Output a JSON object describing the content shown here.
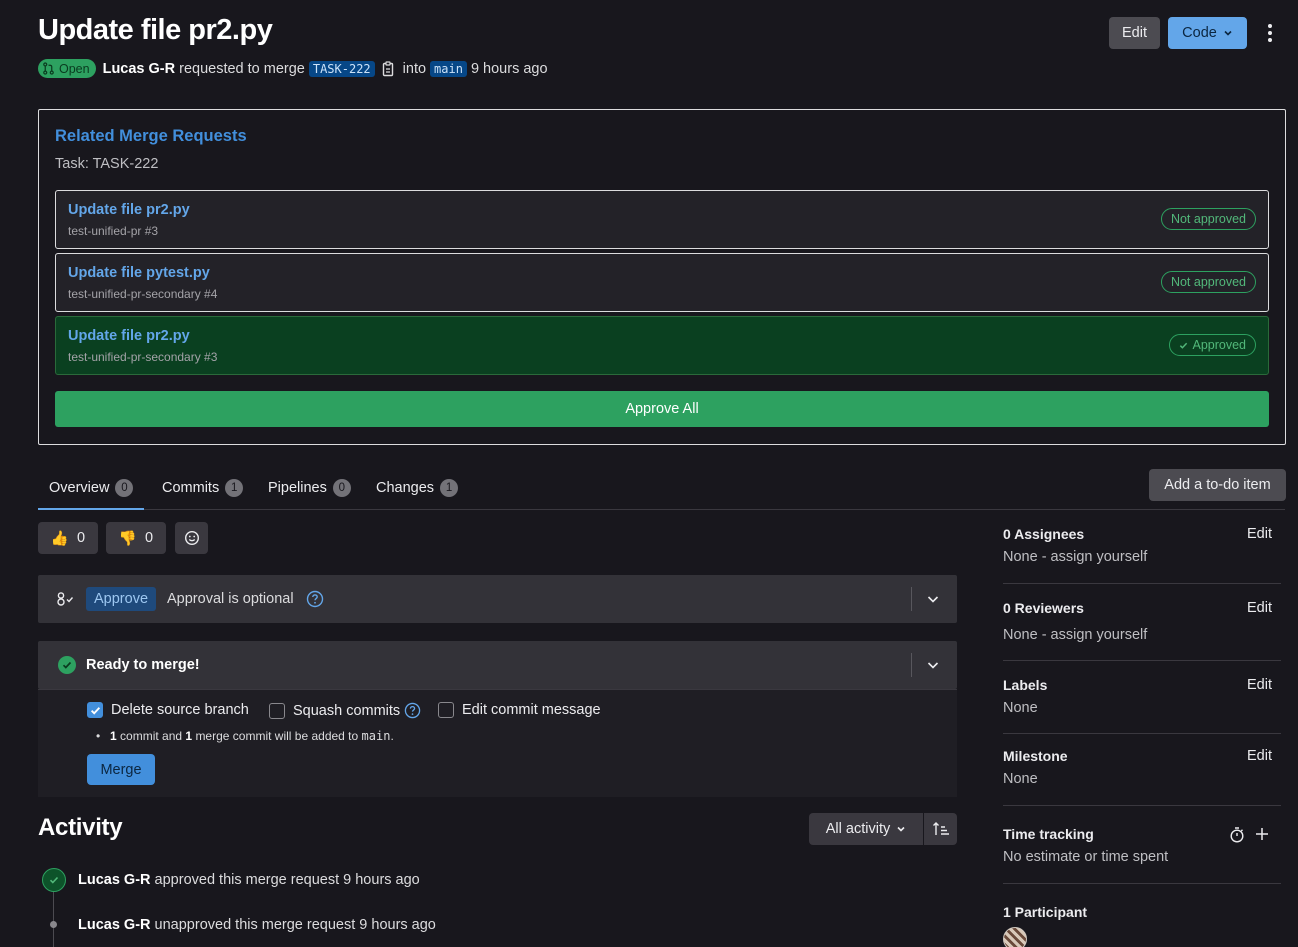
{
  "header": {
    "title": "Update file pr2.py",
    "status": "Open",
    "author": "Lucas G-R",
    "action_text": "requested to merge",
    "source_branch": "TASK-222",
    "into_text": "into",
    "target_branch": "main",
    "time": "9 hours ago",
    "edit_label": "Edit",
    "code_label": "Code"
  },
  "related": {
    "title": "Related Merge Requests",
    "task": "Task: TASK-222",
    "items": [
      {
        "title": "Update file pr2.py",
        "ref": "test-unified-pr #3",
        "status": "Not approved"
      },
      {
        "title": "Update file pytest.py",
        "ref": "test-unified-pr-secondary #4",
        "status": "Not approved"
      },
      {
        "title": "Update file pr2.py",
        "ref": "test-unified-pr-secondary #3",
        "status": "Approved"
      }
    ],
    "approve_all_label": "Approve All"
  },
  "tabs": [
    {
      "label": "Overview",
      "count": "0"
    },
    {
      "label": "Commits",
      "count": "1"
    },
    {
      "label": "Pipelines",
      "count": "0"
    },
    {
      "label": "Changes",
      "count": "1"
    }
  ],
  "todo_label": "Add a to-do item",
  "reactions": {
    "thumbs_up": "0",
    "thumbs_down": "0"
  },
  "approval": {
    "button": "Approve",
    "text": "Approval is optional"
  },
  "merge": {
    "title": "Ready to merge!",
    "delete_branch": "Delete source branch",
    "squash": "Squash commits",
    "edit_message": "Edit commit message",
    "note_count1": "1",
    "note_part1": "commit and",
    "note_count2": "1",
    "note_part2": "merge commit will be added to",
    "note_branch": "main",
    "note_end": ".",
    "button": "Merge"
  },
  "activity": {
    "title": "Activity",
    "filter_label": "All activity",
    "events": [
      {
        "author": "Lucas G-R",
        "text": "approved this merge request 9 hours ago"
      },
      {
        "author": "Lucas G-R",
        "text": "unapproved this merge request 9 hours ago"
      }
    ]
  },
  "sidebar": {
    "assignees": {
      "title": "0 Assignees",
      "value": "None - assign yourself",
      "edit": "Edit"
    },
    "reviewers": {
      "title": "0 Reviewers",
      "value": "None - assign yourself",
      "edit": "Edit"
    },
    "labels": {
      "title": "Labels",
      "value": "None",
      "edit": "Edit"
    },
    "milestone": {
      "title": "Milestone",
      "value": "None",
      "edit": "Edit"
    },
    "time_tracking": {
      "title": "Time tracking",
      "value": "No estimate or time spent"
    },
    "participants": {
      "title": "1 Participant"
    }
  },
  "colors": {
    "accent": "#428fdc",
    "success": "#2da160",
    "background": "#18171d"
  }
}
